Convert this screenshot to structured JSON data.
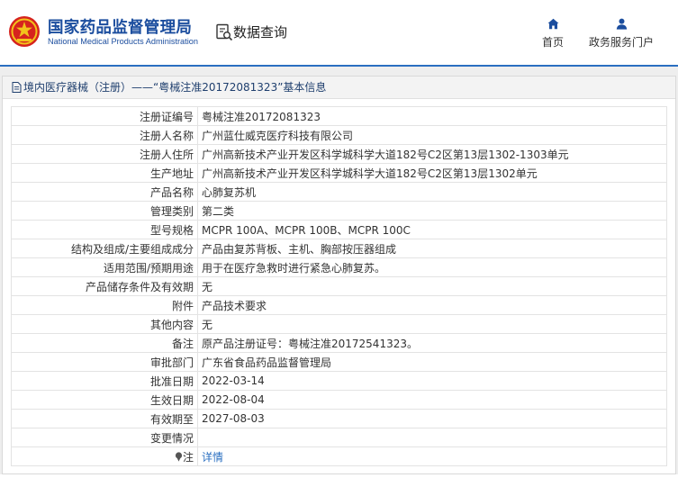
{
  "header": {
    "site_title_cn": "国家药品监督管理局",
    "site_title_en": "National Medical Products Administration",
    "query_title": "数据查询",
    "nav": [
      {
        "label": "首页",
        "icon": "home-icon"
      },
      {
        "label": "政务服务门户",
        "icon": "user-icon"
      }
    ],
    "accent_color": "#2a6fc1"
  },
  "panel": {
    "title": "境内医疗器械（注册）——“粤械注准20172081323”基本信息"
  },
  "rows": [
    {
      "label": "注册证编号",
      "value": "粤械注准20172081323"
    },
    {
      "label": "注册人名称",
      "value": "广州蓝仕威克医疗科技有限公司"
    },
    {
      "label": "注册人住所",
      "value": "广州高新技术产业开发区科学城科学大道182号C2区第13层1302-1303单元"
    },
    {
      "label": "生产地址",
      "value": "广州高新技术产业开发区科学城科学大道182号C2区第13层1302单元"
    },
    {
      "label": "产品名称",
      "value": "心肺复苏机"
    },
    {
      "label": "管理类别",
      "value": "第二类"
    },
    {
      "label": "型号规格",
      "value": "MCPR 100A、MCPR 100B、MCPR 100C"
    },
    {
      "label": "结构及组成/主要组成成分",
      "value": "产品由复苏背板、主机、胸部按压器组成"
    },
    {
      "label": "适用范围/预期用途",
      "value": "用于在医疗急救时进行紧急心肺复苏。"
    },
    {
      "label": "产品储存条件及有效期",
      "value": "无"
    },
    {
      "label": "附件",
      "value": "产品技术要求"
    },
    {
      "label": "其他内容",
      "value": "无"
    },
    {
      "label": "备注",
      "value": "原产品注册证号：粤械注准20172541323。"
    },
    {
      "label": "审批部门",
      "value": "广东省食品药品监督管理局"
    },
    {
      "label": "批准日期",
      "value": "2022-03-14"
    },
    {
      "label": "生效日期",
      "value": "2022-08-04"
    },
    {
      "label": "有效期至",
      "value": "2027-08-03"
    },
    {
      "label": "变更情况",
      "value": ""
    }
  ],
  "note_row": {
    "label": "注",
    "link": "详情",
    "icon": "note-icon"
  }
}
